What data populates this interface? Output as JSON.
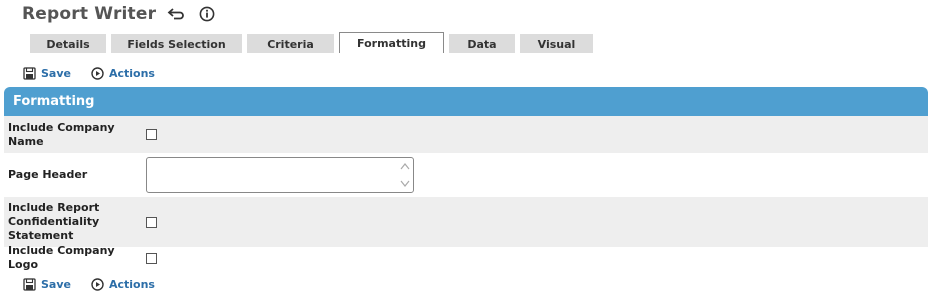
{
  "header": {
    "title": "Report Writer"
  },
  "tabs": [
    {
      "label": "Details",
      "active": false
    },
    {
      "label": "Fields Selection",
      "active": false
    },
    {
      "label": "Criteria",
      "active": false
    },
    {
      "label": "Formatting",
      "active": true
    },
    {
      "label": "Data",
      "active": false
    },
    {
      "label": "Visual",
      "active": false
    }
  ],
  "toolbar": {
    "save_label": "Save",
    "actions_label": "Actions"
  },
  "panel": {
    "title": "Formatting",
    "fields": {
      "include_company_name": {
        "label": "Include Company Name",
        "checked": false
      },
      "page_header": {
        "label": "Page Header",
        "value": ""
      },
      "include_confidentiality": {
        "label": "Include Report Confidentiality Statement",
        "checked": false
      },
      "include_logo": {
        "label": "Include Company Logo",
        "checked": false
      }
    }
  },
  "colors": {
    "accent": "#4f9fd0",
    "link": "#2c6ea8",
    "tab_bg": "#dcdcdc",
    "row_shade": "#eeeeee"
  },
  "icons": [
    "undo-icon",
    "info-icon",
    "save-icon",
    "actions-play-icon",
    "scroll-up-icon",
    "scroll-down-icon"
  ]
}
